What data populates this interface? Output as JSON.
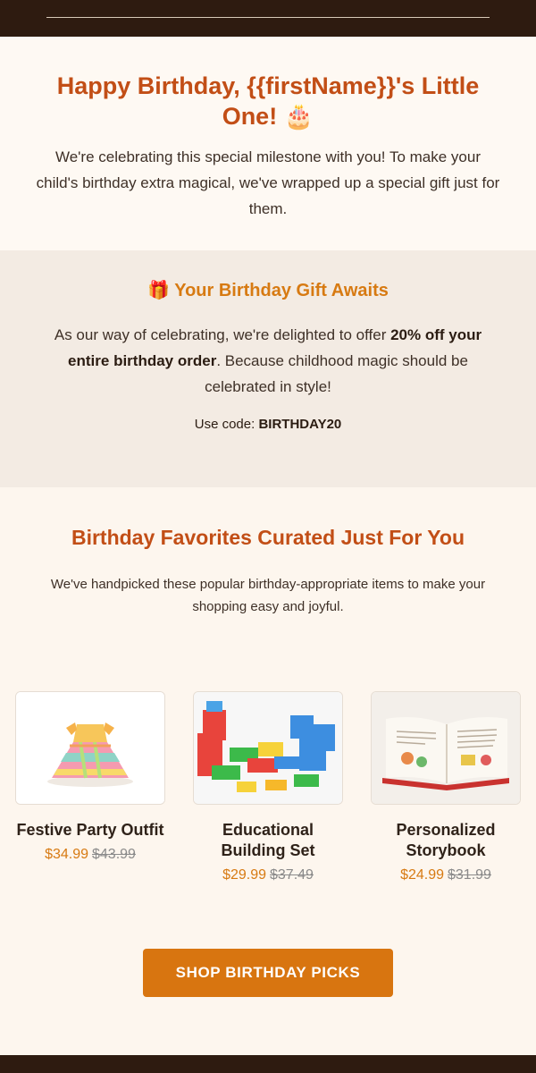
{
  "hero": {
    "title": "Happy Birthday, {{firstName}}'s Little One! 🎂",
    "body": "We're celebrating this special milestone with you! To make your child's birthday extra magical, we've wrapped up a special gift just for them."
  },
  "gift": {
    "title": "🎁 Your Birthday Gift Awaits",
    "body_pre": "As our way of celebrating, we're delighted to offer ",
    "body_bold": "20% off your entire birthday order",
    "body_post": ". Because childhood magic should be celebrated in style!",
    "code_label": "Use code: ",
    "code_value": "BIRTHDAY20"
  },
  "favorites": {
    "title": "Birthday Favorites Curated Just For You",
    "intro": "We've handpicked these popular birthday-appropriate items to make your shopping easy and joyful.",
    "products": [
      {
        "name": "Festive Party Outfit",
        "price": "$34.99",
        "was": "$43.99",
        "image": "party-dress-photo"
      },
      {
        "name": "Educational Building Set",
        "price": "$29.99",
        "was": "$37.49",
        "image": "building-blocks-photo"
      },
      {
        "name": "Personalized Storybook",
        "price": "$24.99",
        "was": "$31.99",
        "image": "open-storybook-photo"
      }
    ]
  },
  "cta": {
    "label": "SHOP BIRTHDAY PICKS"
  },
  "colors": {
    "header_bg": "#2e1b10",
    "title_orange": "#c24e16",
    "accent_orange": "#d77a12",
    "button": "#d87510"
  }
}
